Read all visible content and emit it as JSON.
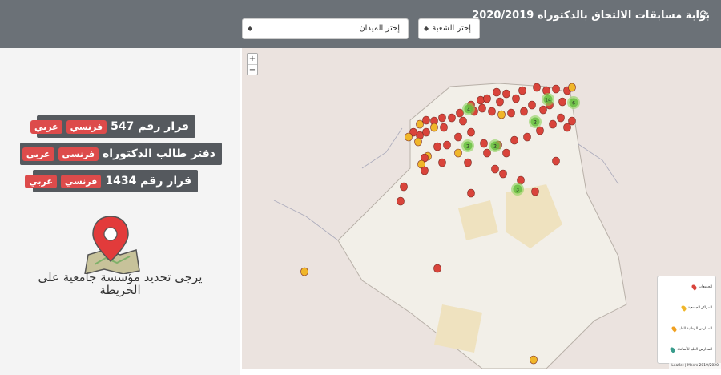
{
  "header": {
    "title": "بوابة مسابقات الالتحاق بالدكتوراه 2020/2019",
    "field_select": "إختر الميدان",
    "branch_select": "إختر الشعبة"
  },
  "documents": [
    {
      "label": "قرار رقم 547",
      "fr": "فرنسي",
      "ar": "عربي"
    },
    {
      "label": "دفتر طالب الدكتوراه",
      "fr": "فرنسي",
      "ar": "عربي"
    },
    {
      "label": "قرار رقم 1434",
      "fr": "فرنسي",
      "ar": "عربي"
    }
  ],
  "hint": "يرجى تحديد مؤسسة جامعية على الخريطة",
  "map": {
    "zoom_in": "+",
    "zoom_out": "−",
    "legend": [
      {
        "label": "الجامعات",
        "color": "#d9443b"
      },
      {
        "label": "المراكز الجامعية",
        "color": "#f0b62a"
      },
      {
        "label": "المدارس الوطنية العليا",
        "color": "#f0a020"
      },
      {
        "label": "المدارس العليا للأساتذة",
        "color": "#3a9c8c"
      }
    ],
    "attribution": "Leaflet | Mesrs 2019/2020",
    "clusters": [
      "4",
      "14",
      "6",
      "2",
      "2",
      "2",
      "3"
    ]
  }
}
